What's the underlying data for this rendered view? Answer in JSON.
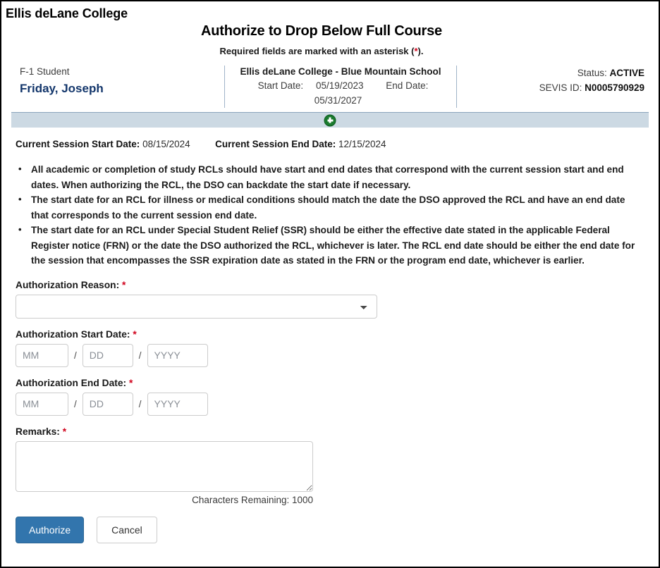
{
  "org": {
    "name": "Ellis deLane College"
  },
  "header": {
    "page_title": "Authorize to Drop Below Full Course",
    "required_note_prefix": "Required fields are marked with an asterisk (",
    "required_note_asterisk": "*",
    "required_note_suffix": ")."
  },
  "student": {
    "visa_type": "F-1 Student",
    "name": "Friday, Joseph",
    "school": "Ellis deLane College - Blue Mountain School",
    "start_date_label": "Start Date:",
    "start_date": "05/19/2023",
    "end_date_label": "End Date:",
    "end_date": "05/31/2027",
    "status_label": "Status:",
    "status_value": "ACTIVE",
    "sevis_label": "SEVIS ID:",
    "sevis_value": "N0005790929"
  },
  "expander": {
    "icon": "plus-circle-icon"
  },
  "session": {
    "start_label": "Current Session Start Date:",
    "start_value": "08/15/2024",
    "end_label": "Current Session End Date:",
    "end_value": "12/15/2024"
  },
  "guidance": {
    "bullets": [
      "All academic or completion of study RCLs should have start and end dates that correspond with the current session start and end dates. When authorizing the RCL, the DSO can backdate the start date if necessary.",
      "The start date for an RCL for illness or medical conditions should match the date the DSO approved the RCL and have an end date that corresponds to the current session end date.",
      "The start date for an RCL under Special Student Relief (SSR) should be either the effective date stated in the applicable Federal Register notice (FRN) or the date the DSO authorized the RCL, whichever is later. The RCL end date should be either the end date for the session that encompasses the SSR expiration date as stated in the FRN or the program end date, whichever is earlier."
    ]
  },
  "form": {
    "reason": {
      "label": "Authorization Reason:",
      "required_marker": "*",
      "selected_value": "",
      "options": [
        ""
      ]
    },
    "start_date": {
      "label": "Authorization Start Date:",
      "required_marker": "*",
      "mm_placeholder": "MM",
      "mm_value": "",
      "dd_placeholder": "DD",
      "dd_value": "",
      "yyyy_placeholder": "YYYY",
      "yyyy_value": "",
      "separator": "/"
    },
    "end_date": {
      "label": "Authorization End Date:",
      "required_marker": "*",
      "mm_placeholder": "MM",
      "mm_value": "",
      "dd_placeholder": "DD",
      "dd_value": "",
      "yyyy_placeholder": "YYYY",
      "yyyy_value": "",
      "separator": "/"
    },
    "remarks": {
      "label": "Remarks:",
      "required_marker": "*",
      "value": "",
      "placeholder": "",
      "characters_remaining": "Characters Remaining: 1000"
    }
  },
  "buttons": {
    "authorize": "Authorize",
    "cancel": "Cancel"
  },
  "colors": {
    "primary_button": "#3275ad",
    "student_name": "#13366b",
    "required_asterisk": "#d0021b",
    "expander_bar": "#ccd9e3",
    "plus_icon_green": "#1a7a2e"
  }
}
